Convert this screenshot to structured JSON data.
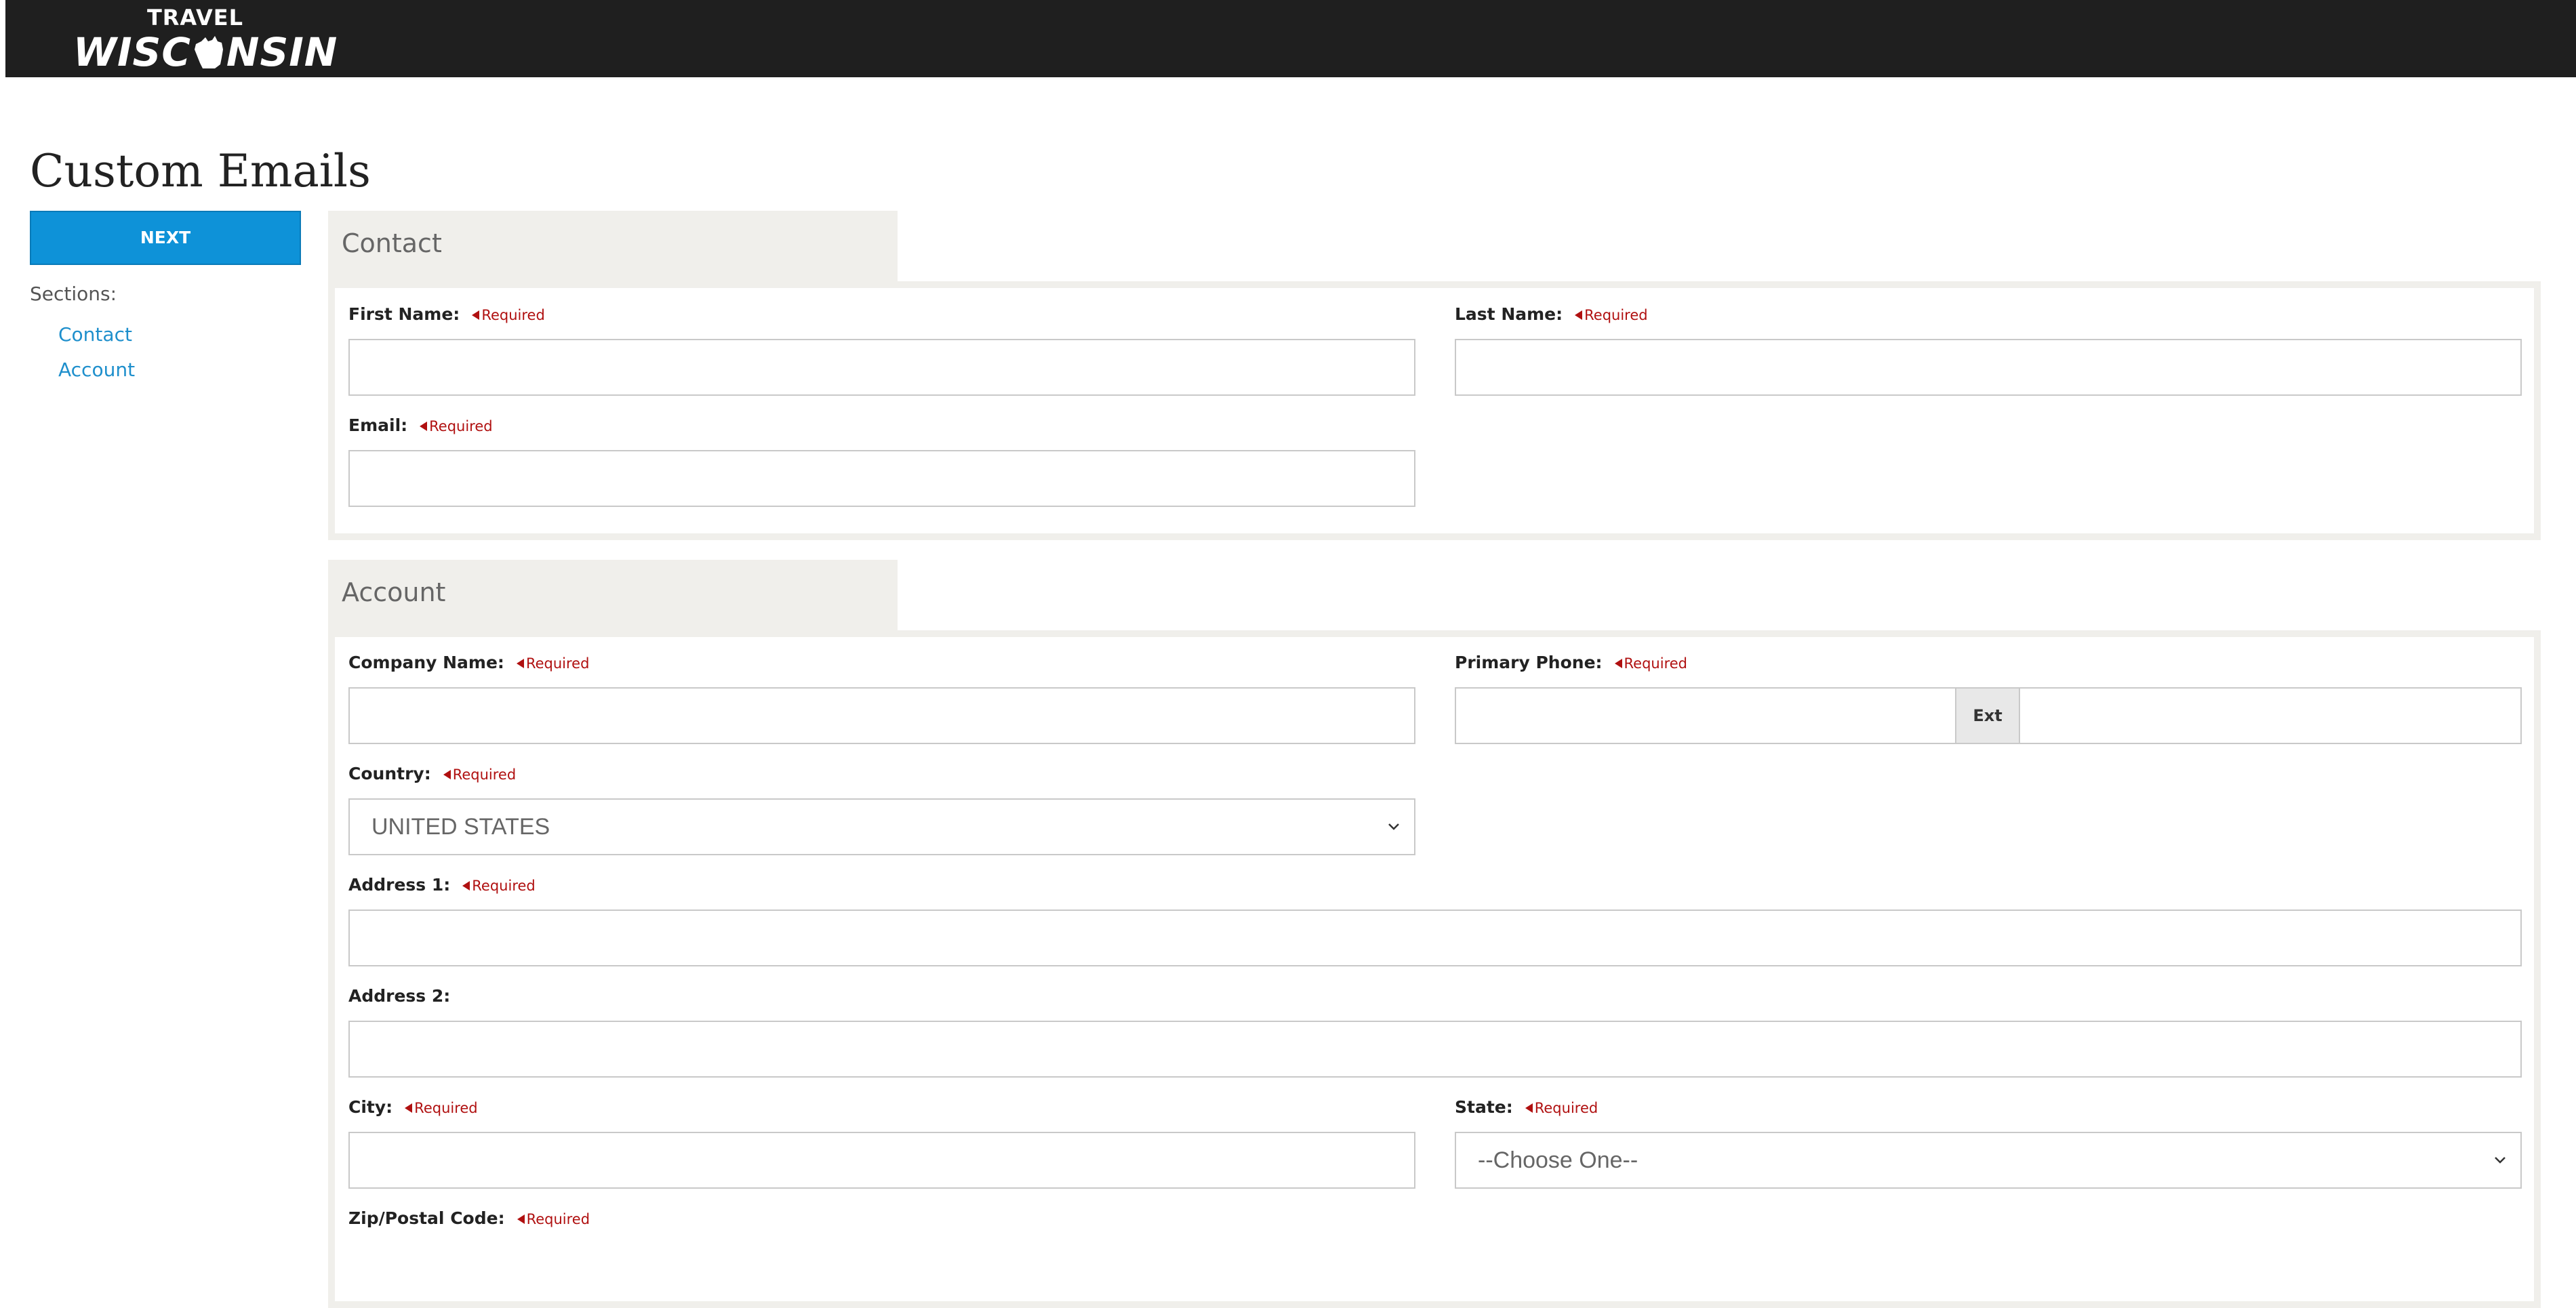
{
  "header": {
    "logo_top": "TRAVEL",
    "logo_left": "WISC",
    "logo_right": "NSIN",
    "logo_icon": "wisconsin-state-icon"
  },
  "page": {
    "title": "Custom Emails"
  },
  "sidebar": {
    "next_label": "NEXT",
    "sections_label": "Sections:",
    "links": [
      "Contact",
      "Account"
    ]
  },
  "required_text": "Required",
  "contact": {
    "heading": "Contact",
    "first_name_label": "First Name:",
    "first_name_value": "",
    "last_name_label": "Last Name:",
    "last_name_value": "",
    "email_label": "Email:",
    "email_value": ""
  },
  "account": {
    "heading": "Account",
    "company_label": "Company Name:",
    "company_value": "",
    "phone_label": "Primary Phone:",
    "phone_value": "",
    "ext_label": "Ext",
    "ext_value": "",
    "country_label": "Country:",
    "country_value": "UNITED STATES",
    "address1_label": "Address 1:",
    "address1_value": "",
    "address2_label": "Address 2:",
    "address2_value": "",
    "city_label": "City:",
    "city_value": "",
    "state_label": "State:",
    "state_value": "--Choose One--",
    "zip_label": "Zip/Postal Code:"
  },
  "colors": {
    "header_bg": "#1f1f1f",
    "accent": "#0e92d8",
    "link": "#1e8fcc",
    "required": "#b01010",
    "panel_bg": "#f0efeb"
  }
}
